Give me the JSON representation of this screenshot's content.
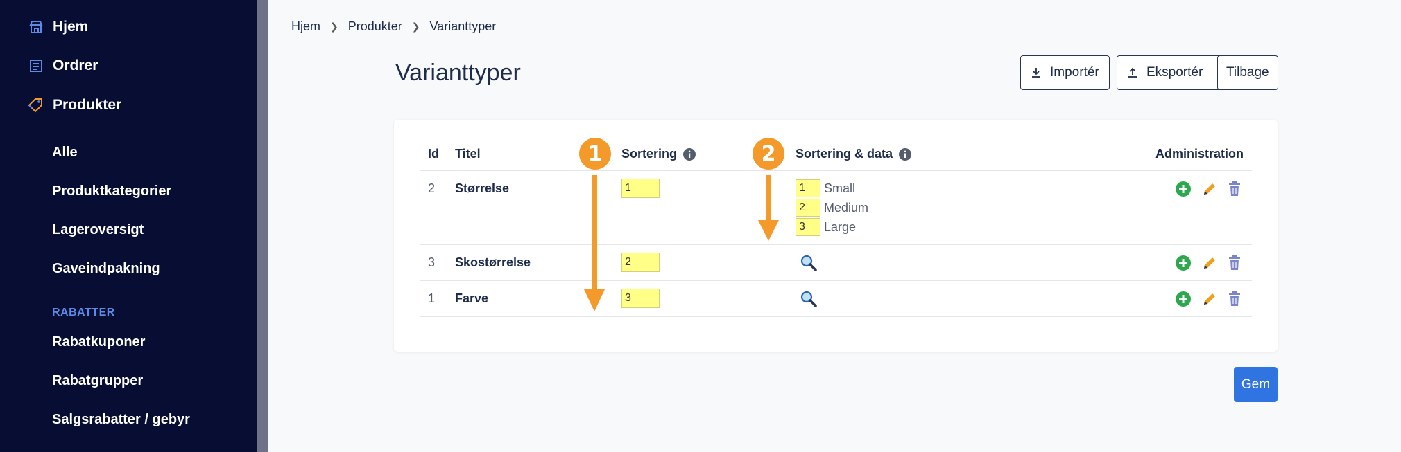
{
  "sidebar": {
    "top_items": [
      {
        "label": "Hjem",
        "icon": "store-icon"
      },
      {
        "label": "Ordrer",
        "icon": "receipt-icon"
      },
      {
        "label": "Produkter",
        "icon": "tags-icon"
      }
    ],
    "sub_items": [
      "Alle",
      "Produktkategorier",
      "Lageroversigt",
      "Gaveindpakning"
    ],
    "section_title": "RABATTER",
    "discount_items": [
      "Rabatkuponer",
      "Rabatgrupper",
      "Salgsrabatter / gebyr"
    ]
  },
  "breadcrumb": {
    "items": [
      "Hjem",
      "Produkter"
    ],
    "current": "Varianttyper"
  },
  "page": {
    "title": "Varianttyper"
  },
  "actions": {
    "import_label": "Importér",
    "export_label": "Eksportér",
    "back_label": "Tilbage",
    "save_label": "Gem"
  },
  "table": {
    "headers": {
      "id": "Id",
      "title": "Titel",
      "sorting": "Sortering",
      "sorting_data": "Sortering & data",
      "admin": "Administration"
    },
    "rows": [
      {
        "id": "2",
        "title": "Størrelse",
        "sort": "1",
        "options": [
          {
            "sort": "1",
            "label": "Small"
          },
          {
            "sort": "2",
            "label": "Medium"
          },
          {
            "sort": "3",
            "label": "Large"
          }
        ]
      },
      {
        "id": "3",
        "title": "Skostørrelse",
        "sort": "2"
      },
      {
        "id": "1",
        "title": "Farve",
        "sort": "3"
      }
    ]
  },
  "annotations": {
    "badge_1": "1",
    "badge_2": "2"
  },
  "colors": {
    "sidebar_bg": "#070d33",
    "accent_blue": "#2f74e0",
    "annotation_orange": "#f39a2b",
    "input_yellow": "#ffff88",
    "add_green": "#2ea84f",
    "edit_orange": "#f0a020",
    "delete_blue": "#7a86c8"
  }
}
